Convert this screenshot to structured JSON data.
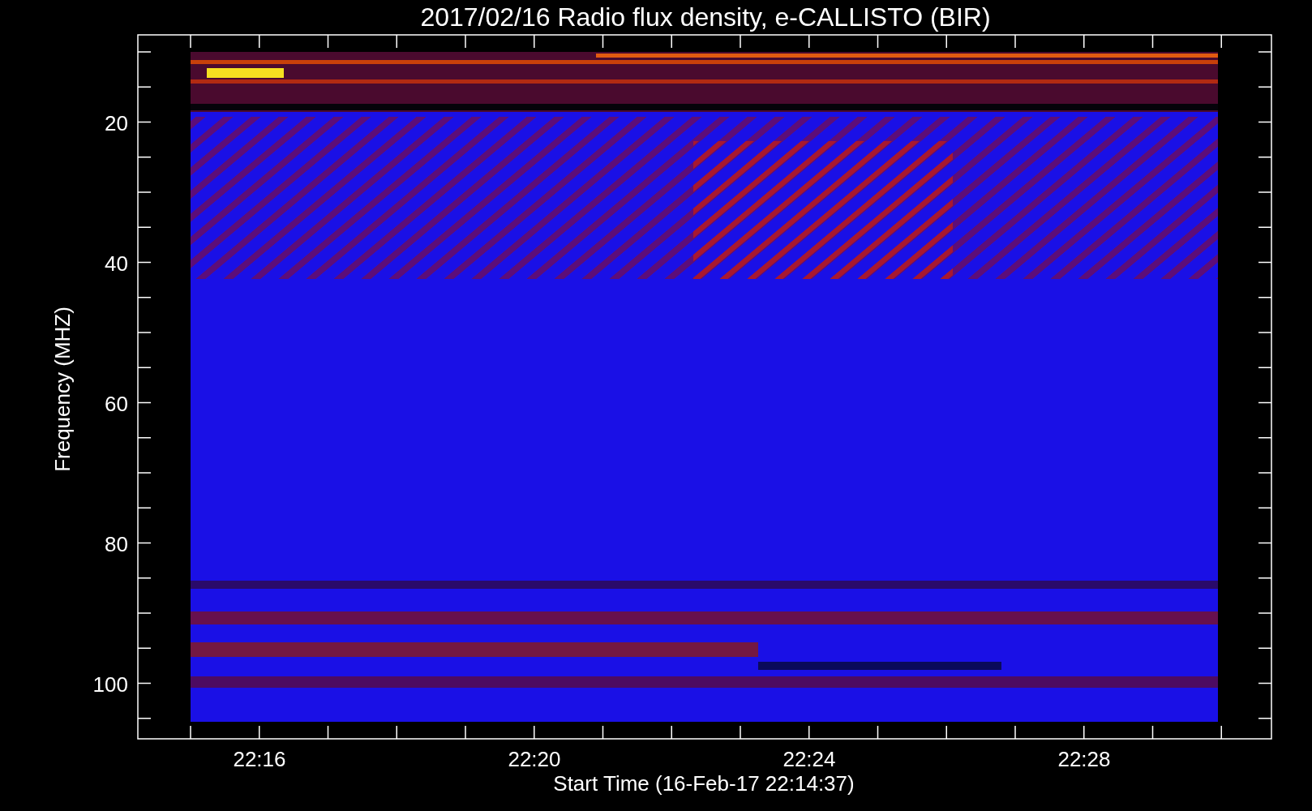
{
  "title": "2017/02/16  Radio flux density, e-CALLISTO (BIR)",
  "y_axis": {
    "label": "Frequency (MHZ)",
    "ticks": [
      "20",
      "40",
      "60",
      "80",
      "100"
    ]
  },
  "x_axis": {
    "label": "Start Time (16-Feb-17 22:14:37)",
    "ticks": [
      "22:16",
      "22:20",
      "22:24",
      "22:28"
    ]
  }
}
